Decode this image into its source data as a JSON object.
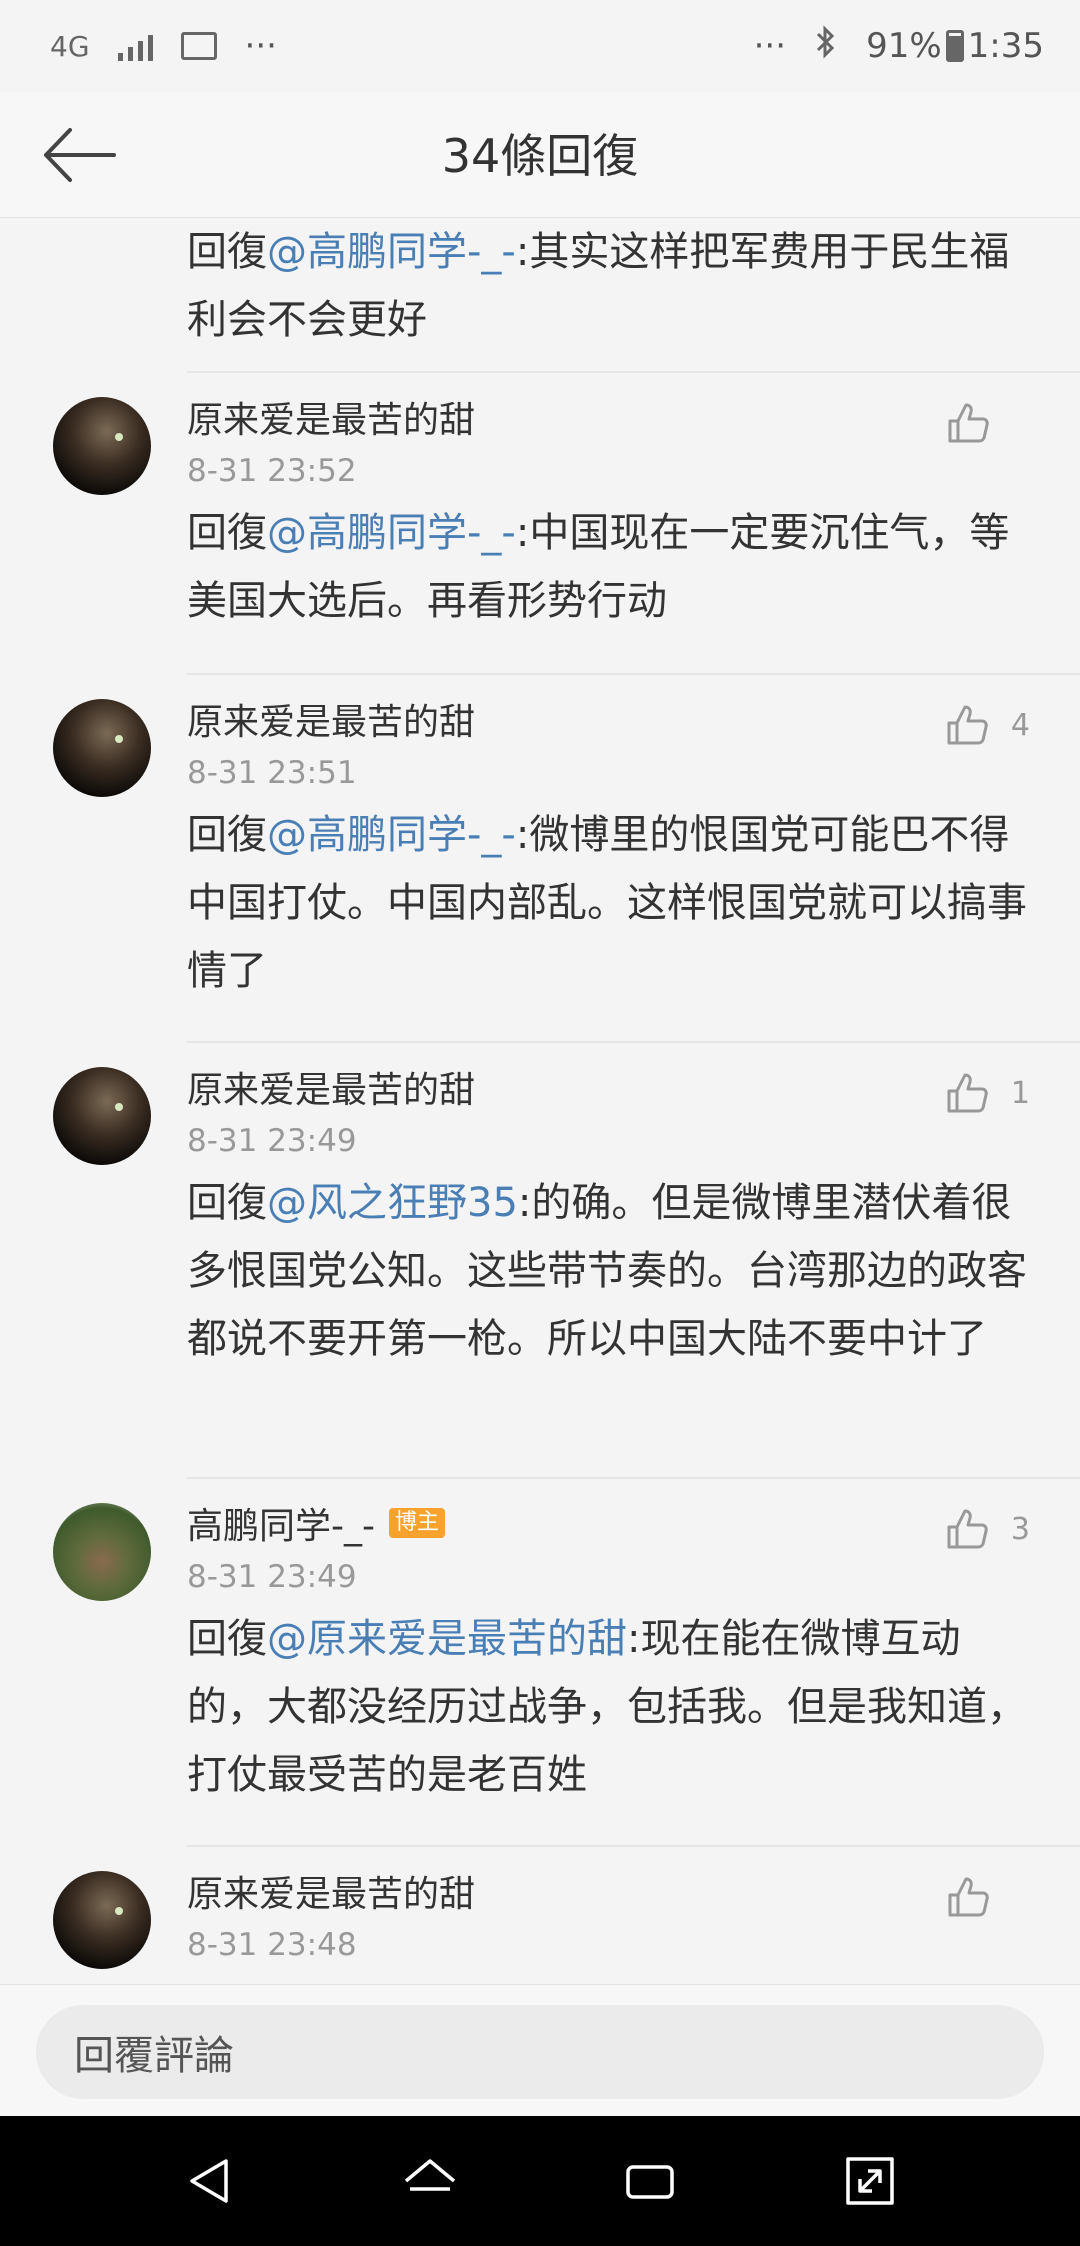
{
  "status_bar": {
    "network": "4G",
    "more_left": "···",
    "more_right": "···",
    "battery": "91%",
    "time": "1:35"
  },
  "header": {
    "title": "34條回復"
  },
  "comments": [
    {
      "partial": true,
      "prefix": "回復",
      "mention": "@高鹏同学-_-",
      "body": ":其实这样把军费用于民生福利会不会更好"
    },
    {
      "username": "原来爱是最苦的甜",
      "time": "8-31 23:52",
      "prefix": "回復",
      "mention": "@高鹏同学-_-",
      "body": ":中国现在一定要沉住气，等美国大选后。再看形势行动",
      "likes": ""
    },
    {
      "username": "原来爱是最苦的甜",
      "time": "8-31 23:51",
      "prefix": "回復",
      "mention": "@高鹏同学-_-",
      "body": ":微博里的恨国党可能巴不得中国打仗。中国内部乱。这样恨国党就可以搞事情了",
      "likes": "4"
    },
    {
      "username": "原来爱是最苦的甜",
      "time": "8-31 23:49",
      "prefix": "回復",
      "mention": "@风之狂野35",
      "body": ":的确。但是微博里潜伏着很多恨国党公知。这些带节奏的。台湾那边的政客都说不要开第一枪。所以中国大陆不要中计了",
      "likes": "1"
    },
    {
      "username": "高鹏同学-_-",
      "badge": "博主",
      "time": "8-31 23:49",
      "prefix": "回復",
      "mention": "@原来爱是最苦的甜",
      "body": ":现在能在微博互动的，大都没经历过战争，包括我。但是我知道，打仗最受苦的是老百姓",
      "likes": "3"
    },
    {
      "username": "原来爱是最苦的甜",
      "time": "8-31 23:48",
      "likes": ""
    }
  ],
  "reply_bar": {
    "placeholder": "回覆評論"
  },
  "colors": {
    "mention": "#4a7fb5",
    "badge": "#f6a22c",
    "background": "#f4f4f4"
  }
}
